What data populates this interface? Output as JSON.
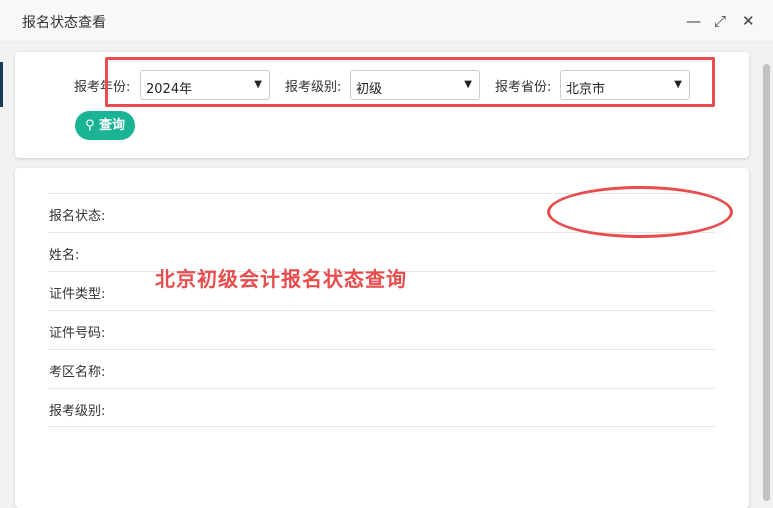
{
  "window": {
    "title": "报名状态查看",
    "minimize": "—",
    "maximize": "⤢",
    "close": "✕"
  },
  "filters": {
    "year": {
      "label": "报考年份:",
      "value": "2024年"
    },
    "level": {
      "label": "报考级别:",
      "value": "初级"
    },
    "province": {
      "label": "报考省份:",
      "value": "北京市"
    },
    "query_button": "查询"
  },
  "results": {
    "rows": [
      {
        "label": "报名状态:"
      },
      {
        "label": "姓名:"
      },
      {
        "label": "证件类型:"
      },
      {
        "label": "证件号码:"
      },
      {
        "label": "考区名称:"
      },
      {
        "label": "报考级别:"
      }
    ]
  },
  "annotation": {
    "text": "北京初级会计报名状态查询",
    "color": "#e84c4c"
  }
}
